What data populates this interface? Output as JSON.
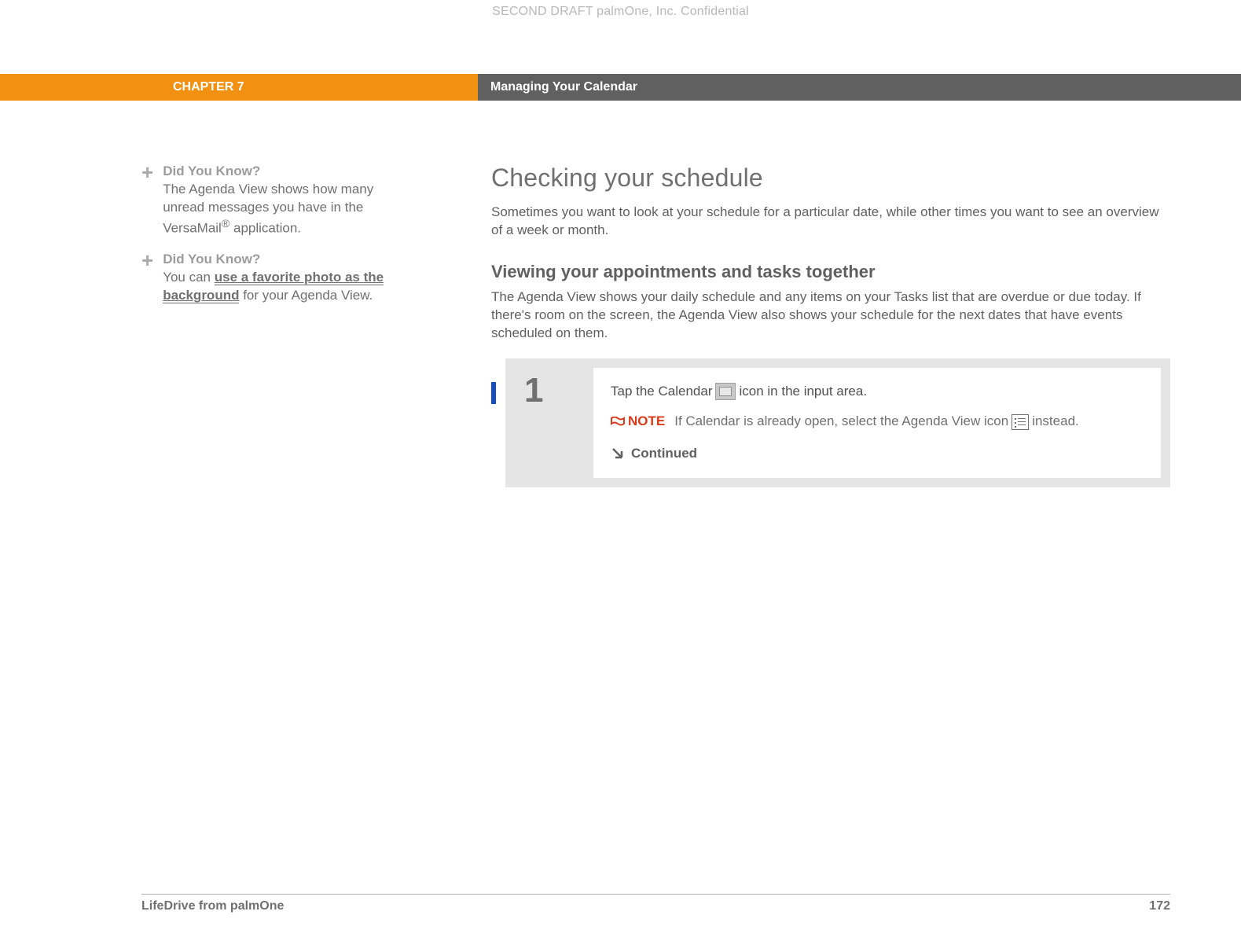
{
  "confidential": "SECOND DRAFT palmOne, Inc.  Confidential",
  "header": {
    "chapter": "CHAPTER 7",
    "title": "Managing Your Calendar"
  },
  "sidebar": {
    "items": [
      {
        "title": "Did You Know?",
        "body_pre": "The Agenda View shows how many unread messages you have in the VersaMail",
        "body_sup": "®",
        "body_post": " application."
      },
      {
        "title": "Did You Know?",
        "body_pre": "You can ",
        "link": "use a favorite photo as the background",
        "body_post": " for your Agenda View."
      }
    ]
  },
  "main": {
    "h1": "Checking your schedule",
    "intro": "Sometimes you want to look at your schedule for a particular date, while other times you want to see an overview of a week or month.",
    "h2": "Viewing your appointments and tasks together",
    "sub_intro": "The Agenda View shows your daily schedule and any items on your Tasks list that are overdue or due today. If there's room on the screen, the Agenda View also shows your schedule for the next dates that have events scheduled on them.",
    "step_number": "1",
    "step_line1_a": "Tap the Calendar ",
    "step_line1_b": " icon in the input area.",
    "note_label": "NOTE",
    "note_text_a": "If Calendar is already open, select the Agenda View icon ",
    "note_text_b": " instead.",
    "continued": "Continued"
  },
  "footer": {
    "product": "LifeDrive from palmOne",
    "page": "172"
  }
}
